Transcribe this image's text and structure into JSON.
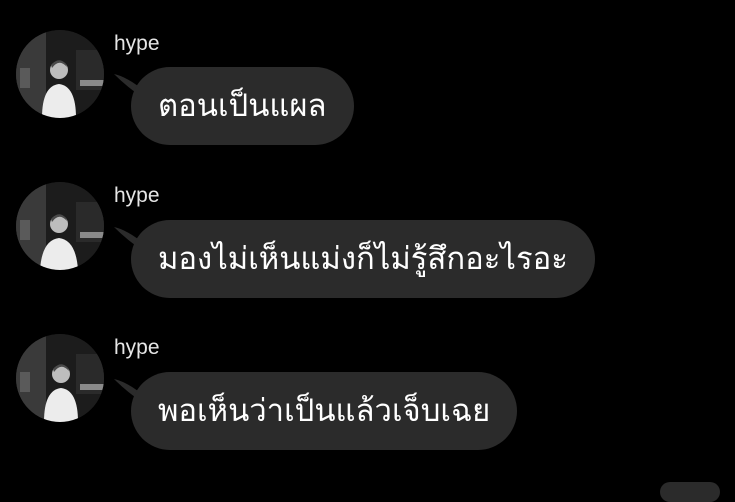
{
  "messages": [
    {
      "sender": "hype",
      "text": "ตอนเป็นแผล",
      "avatar_icon": "profile-photo-icon"
    },
    {
      "sender": "hype",
      "text": "มองไม่เห็นแม่งก็ไม่รู้สึกอะไรอะ",
      "avatar_icon": "profile-photo-icon"
    },
    {
      "sender": "hype",
      "text": "พอเห็นว่าเป็นแล้วเจ็บเฉย",
      "avatar_icon": "profile-photo-icon"
    }
  ],
  "colors": {
    "background": "#000000",
    "bubble": "#2b2b2b",
    "text": "#ffffff",
    "name": "#e6e6e6"
  }
}
